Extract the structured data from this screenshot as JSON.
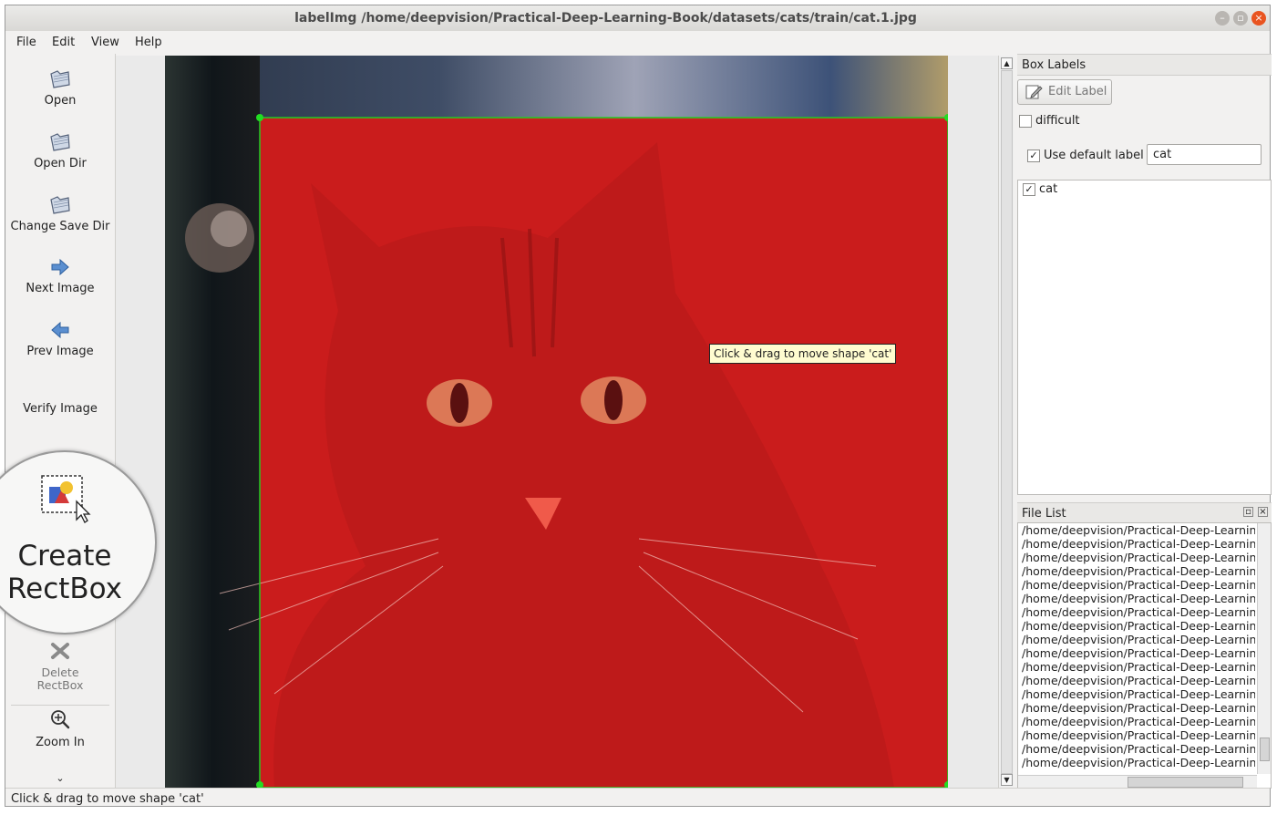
{
  "window": {
    "title": "labelImg /home/deepvision/Practical-Deep-Learning-Book/datasets/cats/train/cat.1.jpg"
  },
  "menu": [
    "File",
    "Edit",
    "View",
    "Help"
  ],
  "toolbar": {
    "open": "Open",
    "open_dir": "Open Dir",
    "change_save_dir": "Change Save Dir",
    "next_image": "Next Image",
    "prev_image": "Prev Image",
    "verify_image": "Verify Image",
    "create_rectbox_line1": "Create",
    "create_rectbox_line2": "RectBox",
    "delete_rectbox_line1": "Delete",
    "delete_rectbox_line2": "RectBox",
    "zoom_in": "Zoom In",
    "more": "⌄"
  },
  "canvas": {
    "tooltip": "Click & drag to move shape 'cat'",
    "box_color": "#dc1e1e",
    "box_border_color": "#22cc22"
  },
  "box_labels": {
    "title": "Box Labels",
    "edit_label_button": "Edit Label",
    "difficult_label": "difficult",
    "difficult_checked": false,
    "use_default_label": "Use default label",
    "use_default_checked": true,
    "default_label_value": "cat",
    "labels": [
      {
        "name": "cat",
        "checked": true
      }
    ]
  },
  "file_list": {
    "title": "File List",
    "items": [
      "/home/deepvision/Practical-Deep-Learning",
      "/home/deepvision/Practical-Deep-Learning",
      "/home/deepvision/Practical-Deep-Learning",
      "/home/deepvision/Practical-Deep-Learning",
      "/home/deepvision/Practical-Deep-Learning",
      "/home/deepvision/Practical-Deep-Learning",
      "/home/deepvision/Practical-Deep-Learning",
      "/home/deepvision/Practical-Deep-Learning",
      "/home/deepvision/Practical-Deep-Learning",
      "/home/deepvision/Practical-Deep-Learning",
      "/home/deepvision/Practical-Deep-Learning",
      "/home/deepvision/Practical-Deep-Learning",
      "/home/deepvision/Practical-Deep-Learning",
      "/home/deepvision/Practical-Deep-Learning",
      "/home/deepvision/Practical-Deep-Learning",
      "/home/deepvision/Practical-Deep-Learning",
      "/home/deepvision/Practical-Deep-Learning",
      "/home/deepvision/Practical-Deep-Learning"
    ]
  },
  "status": {
    "text": "Click & drag to move shape 'cat'"
  }
}
